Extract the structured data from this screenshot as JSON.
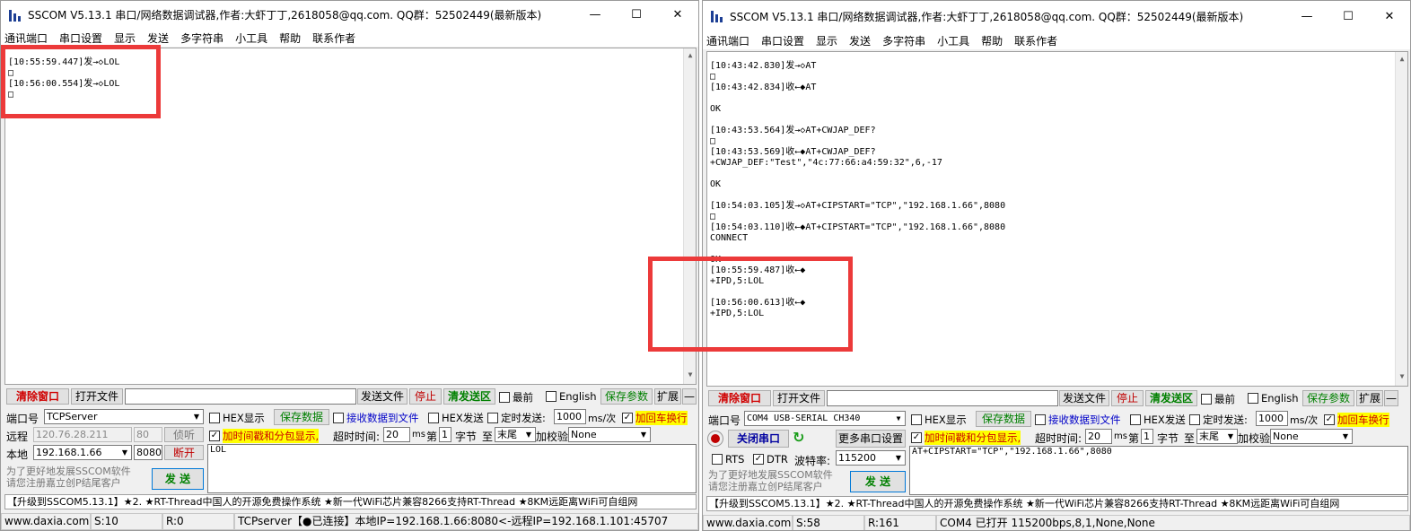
{
  "app": {
    "title": "SSCOM V5.13.1 串口/网络数据调试器,作者:大虾丁丁,2618058@qq.com. QQ群：52502449(最新版本)"
  },
  "menu": [
    "通讯端口",
    "串口设置",
    "显示",
    "发送",
    "多字符串",
    "小工具",
    "帮助",
    "联系作者"
  ],
  "common": {
    "clear_btn": "清除窗口",
    "open_file_btn": "打开文件",
    "send_file_btn": "发送文件",
    "stop_btn": "停止",
    "clear_send_btn": "清发送区",
    "topmost": "最前",
    "english": "English",
    "save_params": "保存参数",
    "expand": "扩展",
    "hex_display": "HEX显示",
    "save_data": "保存数据",
    "recv_to_file": "接收数据到文件",
    "hex_send": "HEX发送",
    "timed_send": "定时发送:",
    "interval": "1000",
    "interval_unit": "ms/次",
    "add_crlf": "加回车换行",
    "timestamp": "加时间戳和分包显示,",
    "timeout_label": "超时时间:",
    "timeout": "20",
    "timeout_unit": "ms",
    "nth": "第",
    "byte_idx": "1",
    "byte_label": "字节",
    "to": "至",
    "end": "末尾",
    "checksum": "加校验",
    "checksum_val": "None",
    "promo1": "为了更好地发展SSCOM软件",
    "promo2": "请您注册嘉立创P结尾客户",
    "send_btn": "发 送",
    "news": "【升级到SSCOM5.13.1】★2. ★RT-Thread中国人的开源免费操作系统 ★新一代WiFi芯片兼容8266支持RT-Thread ★8KM远距离WiFi可自组网",
    "url": "www.daxia.com",
    "close_icon": "✕",
    "minimize_icon": "—",
    "maximize_icon": "☐"
  },
  "left": {
    "log": [
      "[10:55:59.447]发→◇LOL",
      "□",
      "[10:56:00.554]发→◇LOL",
      "□"
    ],
    "port_label": "端口号",
    "port_value": "TCPServer",
    "remote_label": "远程",
    "remote_ip": "120.76.28.211",
    "remote_port": "80",
    "listen_btn": "侦听",
    "local_label": "本地",
    "local_ip": "192.168.1.66",
    "local_port": "8080",
    "disconnect_btn": "断开",
    "send_text": "LOL",
    "status": {
      "s": "S:10",
      "r": "R:0",
      "info": "TCPserver【●已连接】本地IP=192.168.1.66:8080<-远程IP=192.168.1.101:45707"
    }
  },
  "right": {
    "log": [
      "[10:43:42.830]发→◇AT",
      "□",
      "[10:43:42.834]收←◆AT",
      "",
      "OK",
      "",
      "[10:43:53.564]发→◇AT+CWJAP_DEF?",
      "□",
      "[10:43:53.569]收←◆AT+CWJAP_DEF?",
      "+CWJAP_DEF:\"Test\",\"4c:77:66:a4:59:32\",6,-17",
      "",
      "OK",
      "",
      "[10:54:03.105]发→◇AT+CIPSTART=\"TCP\",\"192.168.1.66\",8080",
      "□",
      "[10:54:03.110]收←◆AT+CIPSTART=\"TCP\",\"192.168.1.66\",8080",
      "CONNECT",
      "",
      "OK",
      "[10:55:59.487]收←◆",
      "+IPD,5:LOL",
      "",
      "[10:56:00.613]收←◆",
      "+IPD,5:LOL"
    ],
    "port_label": "端口号",
    "port_value": "COM4 USB-SERIAL CH340",
    "close_port_btn": "关闭串口",
    "more_settings_btn": "更多串口设置",
    "rts": "RTS",
    "dtr": "DTR",
    "baud_label": "波特率:",
    "baud": "115200",
    "send_text": "AT+CIPSTART=\"TCP\",\"192.168.1.66\",8080",
    "status": {
      "s": "S:58",
      "r": "R:161",
      "info": "COM4 已打开  115200bps,8,1,None,None"
    }
  }
}
